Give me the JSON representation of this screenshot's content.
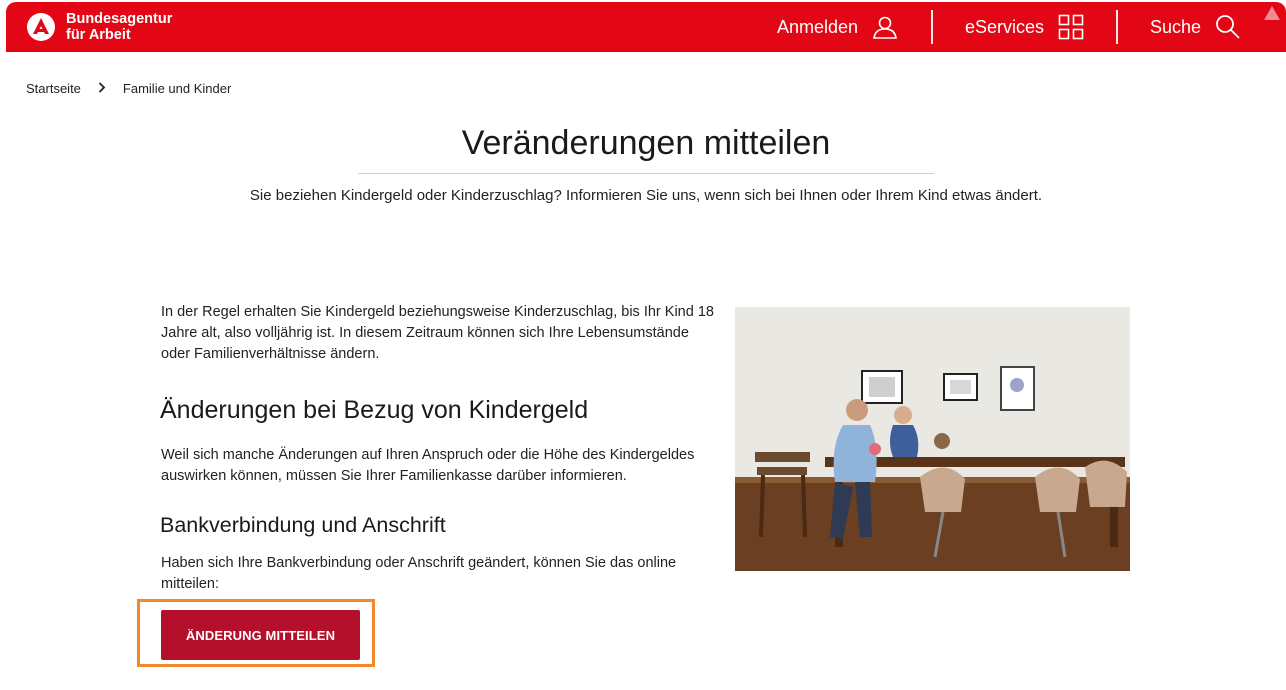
{
  "header": {
    "logo_line1": "Bundesagentur",
    "logo_line2": "für Arbeit",
    "nav": {
      "login_label": "Anmelden",
      "eservices_label": "eServices",
      "search_label": "Suche"
    },
    "brand_color": "#e30614"
  },
  "breadcrumb": {
    "items": [
      "Startseite",
      "Familie und Kinder"
    ],
    "separator": ">"
  },
  "page": {
    "title": "Veränderungen mitteilen",
    "subtitle": "Sie beziehen Kindergeld oder Kinderzuschlag? Informieren Sie uns, wenn sich bei Ihnen oder Ihrem Kind etwas ändert.",
    "intro": "In der Regel erhalten Sie Kindergeld beziehungsweise Kinderzuschlag, bis Ihr Kind 18 Jahre alt, also volljährig ist. In diesem Zeitraum können sich Ihre Lebensumstände oder Familienverhältnisse ändern.",
    "section_heading": "Änderungen bei Bezug von Kindergeld",
    "section_text": "Weil sich manche Änderungen auf Ihren Anspruch oder die Höhe des Kindergeldes auswirken können, müssen Sie Ihrer Familienkasse darüber informieren.",
    "sub_heading": "Bankverbindung und Anschrift",
    "sub_text": "Haben sich Ihre Bankverbindung oder Anschrift geändert, können Sie das online mitteilen:",
    "cta_label": "ÄNDERUNG MITTEILEN",
    "cta_color": "#b5102b",
    "focus_color": "#f4892a"
  }
}
